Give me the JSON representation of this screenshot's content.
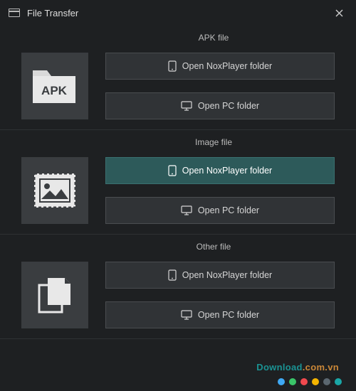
{
  "window": {
    "title": "File Transfer"
  },
  "sections": {
    "apk": {
      "heading": "APK file",
      "btn_nox": "Open NoxPlayer folder",
      "btn_pc": "Open PC folder"
    },
    "image": {
      "heading": "Image file",
      "btn_nox": "Open NoxPlayer folder",
      "btn_pc": "Open PC folder"
    },
    "other": {
      "heading": "Other file",
      "btn_nox": "Open NoxPlayer folder",
      "btn_pc": "Open PC folder"
    }
  },
  "watermark": {
    "text_main": "Download",
    "text_suffix": ".com.vn"
  },
  "dot_colors": [
    "#3fa9f5",
    "#3ac569",
    "#f0494e",
    "#f4b400",
    "#5b6770",
    "#1aa7a7"
  ]
}
